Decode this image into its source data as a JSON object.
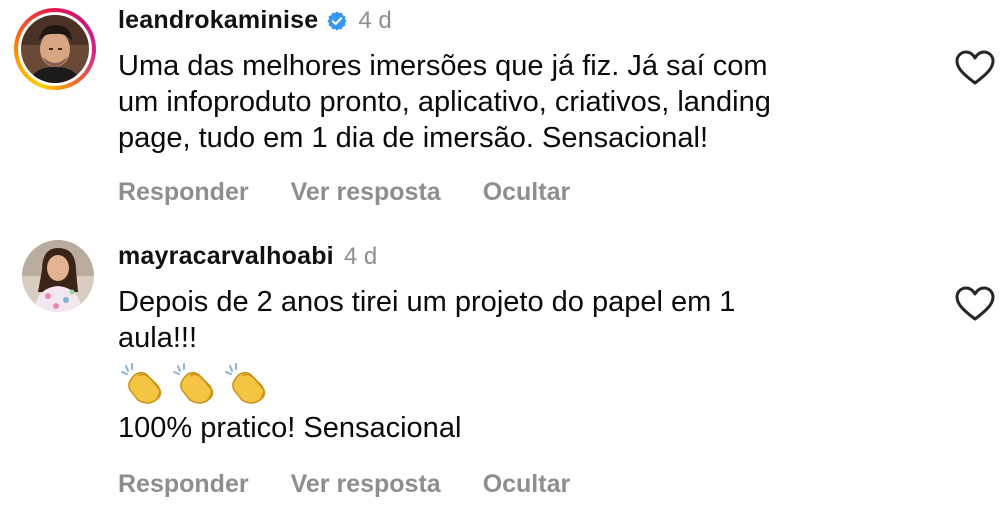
{
  "comments": [
    {
      "username": "leandrokaminise",
      "verified": true,
      "timestamp": "4 d",
      "lines": [
        "Uma das melhores imersões que já fiz. Já saí com",
        "um infoproduto pronto, aplicativo, criativos, landing",
        "page, tudo em 1 dia de imersão. Sensacional!"
      ],
      "actions": {
        "reply": "Responder",
        "view_reply": "Ver resposta",
        "hide": "Ocultar"
      },
      "has_story_ring": true,
      "icons": [
        "verified-badge-icon",
        "heart-outline-icon"
      ]
    },
    {
      "username": "mayracarvalhoabi",
      "verified": false,
      "timestamp": "4 d",
      "lines_before_emoji": [
        "Depois de 2 anos tirei um projeto do papel em 1",
        "aula!!!"
      ],
      "emoji": "👏👏👏",
      "lines_after_emoji": [
        "100% pratico! Sensacional"
      ],
      "actions": {
        "reply": "Responder",
        "view_reply": "Ver resposta",
        "hide": "Ocultar"
      },
      "has_story_ring": false,
      "icons": [
        "heart-outline-icon"
      ]
    }
  ],
  "colors": {
    "text": "#0a0a0a",
    "muted": "#8e8e8e",
    "verified_blue": "#3897f0"
  }
}
